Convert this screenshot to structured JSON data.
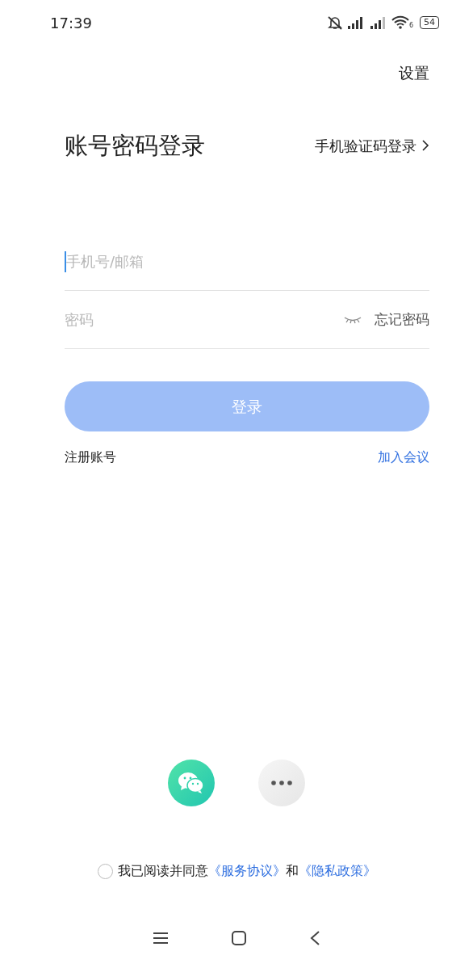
{
  "status_bar": {
    "time": "17:39",
    "wifi_badge": "6",
    "battery": "54"
  },
  "settings": "设置",
  "title": "账号密码登录",
  "sms_login": "手机验证码登录",
  "account_field": {
    "placeholder": "手机号/邮箱",
    "focused": true
  },
  "password_field": {
    "placeholder": "密码",
    "password_visible": false
  },
  "forgot_password": "忘记密码",
  "login_button": {
    "label": "登录",
    "disabled": true
  },
  "register": "注册账号",
  "join_meeting": "加入会议",
  "agreement": {
    "checked": false,
    "text": "我已阅读并同意",
    "terms": "《服务协议》",
    "and": "和",
    "privacy": "《隐私政策》"
  }
}
